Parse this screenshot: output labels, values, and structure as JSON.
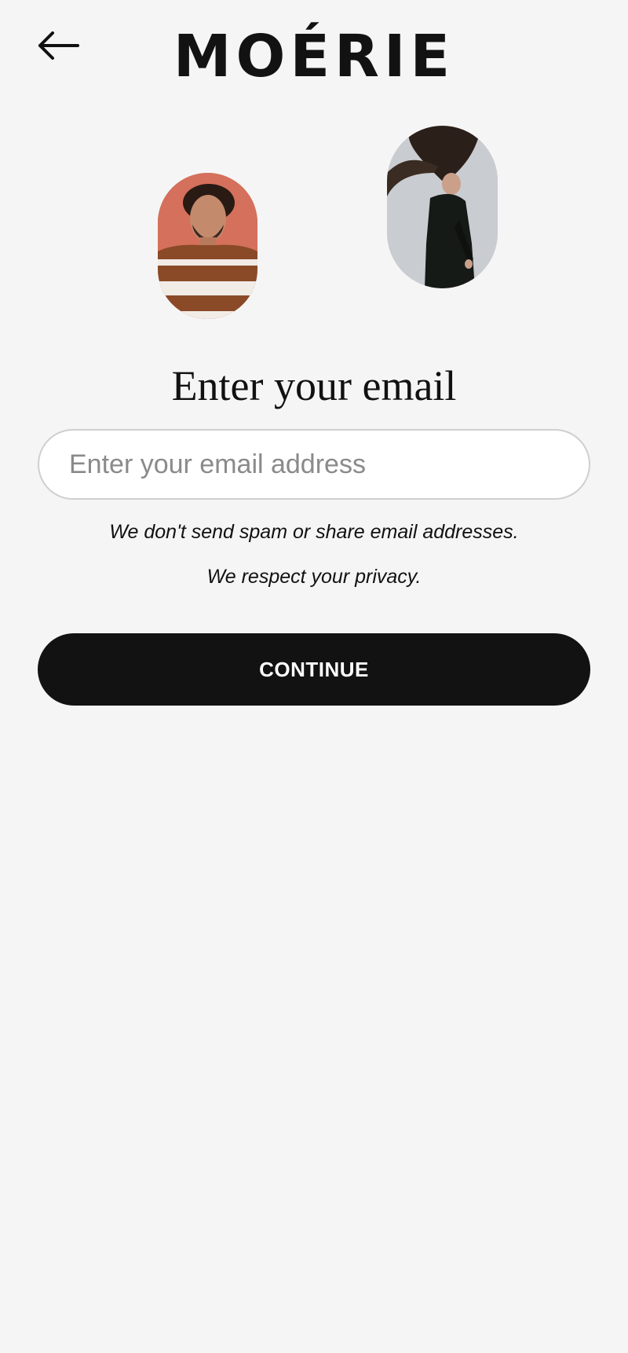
{
  "header": {
    "brand": "MOÉRIE",
    "back_icon": "arrow-left-icon"
  },
  "photos": [
    {
      "name": "man-striped-sweater-photo",
      "bg": "#d4705b"
    },
    {
      "name": "woman-hair-flip-photo",
      "bg": "#c9ccd0"
    }
  ],
  "main": {
    "title": "Enter your email",
    "email_input": {
      "value": "",
      "placeholder": "Enter your email address"
    },
    "note_spam": "We don't send spam or share email addresses.",
    "note_privacy": "We respect your privacy.",
    "continue_label": "CONTINUE"
  },
  "colors": {
    "background": "#f5f5f5",
    "button": "#121212",
    "button_text": "#ffffff",
    "input_border": "#cfcfcf"
  }
}
